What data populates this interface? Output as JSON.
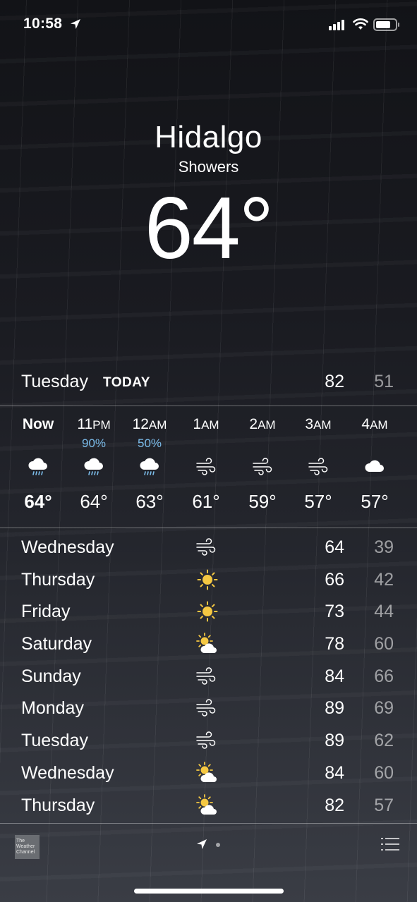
{
  "status_bar": {
    "time": "10:58"
  },
  "location": {
    "city": "Hidalgo",
    "condition": "Showers",
    "temperature": "64°"
  },
  "today": {
    "day": "Tuesday",
    "label": "TODAY",
    "high": "82",
    "low": "51"
  },
  "hourly": [
    {
      "label": "Now",
      "ampm": "",
      "pop": "",
      "icon": "rain-cloud-icon",
      "temp": "64°"
    },
    {
      "label": "11",
      "ampm": "PM",
      "pop": "90%",
      "icon": "rain-cloud-icon",
      "temp": "64°"
    },
    {
      "label": "12",
      "ampm": "AM",
      "pop": "50%",
      "icon": "rain-cloud-icon",
      "temp": "63°"
    },
    {
      "label": "1",
      "ampm": "AM",
      "pop": "",
      "icon": "wind-icon",
      "temp": "61°"
    },
    {
      "label": "2",
      "ampm": "AM",
      "pop": "",
      "icon": "wind-icon",
      "temp": "59°"
    },
    {
      "label": "3",
      "ampm": "AM",
      "pop": "",
      "icon": "wind-icon",
      "temp": "57°"
    },
    {
      "label": "4",
      "ampm": "AM",
      "pop": "",
      "icon": "cloud-icon",
      "temp": "57°"
    }
  ],
  "daily": [
    {
      "day": "Wednesday",
      "icon": "wind-icon",
      "high": "64",
      "low": "39"
    },
    {
      "day": "Thursday",
      "icon": "sun-icon",
      "high": "66",
      "low": "42"
    },
    {
      "day": "Friday",
      "icon": "sun-icon",
      "high": "73",
      "low": "44"
    },
    {
      "day": "Saturday",
      "icon": "partly-cloudy-icon",
      "high": "78",
      "low": "60"
    },
    {
      "day": "Sunday",
      "icon": "wind-icon",
      "high": "84",
      "low": "66"
    },
    {
      "day": "Monday",
      "icon": "wind-icon",
      "high": "89",
      "low": "69"
    },
    {
      "day": "Tuesday",
      "icon": "wind-icon",
      "high": "89",
      "low": "62"
    },
    {
      "day": "Wednesday",
      "icon": "partly-cloudy-icon",
      "high": "84",
      "low": "60"
    },
    {
      "day": "Thursday",
      "icon": "partly-cloudy-icon",
      "high": "82",
      "low": "57"
    }
  ],
  "footer": {
    "logo_text": "The Weather Channel"
  },
  "colors": {
    "precip": "#7bbcea",
    "sun": "#f5c842"
  }
}
